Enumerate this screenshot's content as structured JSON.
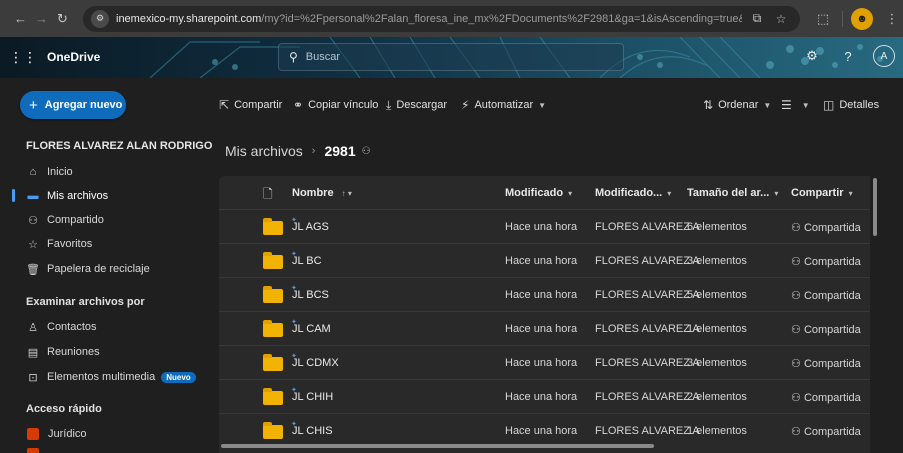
{
  "browser": {
    "url_host": "inemexico-my.sharepoint.com",
    "url_path": "/my?id=%2Fpersonal%2Falan_floresa_ine_mx%2FDocuments%2F2981&ga=1&isAscending=true&sortField=LinkFile..."
  },
  "header": {
    "brand": "OneDrive",
    "search_placeholder": "Buscar",
    "avatar": "A"
  },
  "sidebar": {
    "new_button": "Agregar nuevo",
    "user_name": "FLORES ALVAREZ ALAN RODRIGO",
    "items": [
      {
        "label": "Inicio",
        "icon": "home-icon"
      },
      {
        "label": "Mis archivos",
        "icon": "folder-icon"
      },
      {
        "label": "Compartido",
        "icon": "people-icon"
      },
      {
        "label": "Favoritos",
        "icon": "star-icon"
      },
      {
        "label": "Papelera de reciclaje",
        "icon": "trash-icon"
      }
    ],
    "browse_section": "Examinar archivos por",
    "browse_items": [
      {
        "label": "Contactos",
        "icon": "contact-icon"
      },
      {
        "label": "Reuniones",
        "icon": "meeting-icon"
      },
      {
        "label": "Elementos multimedia",
        "icon": "media-icon",
        "badge": "Nuevo"
      }
    ],
    "quick_section": "Acceso rápido",
    "quick_items": [
      {
        "label": "Jurídico",
        "color": "#d83b01"
      }
    ]
  },
  "commands": {
    "share": "Compartir",
    "copy_link": "Copiar vínculo",
    "download": "Descargar",
    "automate": "Automatizar",
    "sort": "Ordenar",
    "details": "Detalles"
  },
  "breadcrumb": {
    "root": "Mis archivos",
    "current": "2981"
  },
  "table": {
    "columns": {
      "name": "Nombre",
      "modified": "Modificado",
      "modified_by": "Modificado...",
      "size": "Tamaño del ar...",
      "sharing": "Compartir"
    },
    "rows": [
      {
        "name": "JL AGS",
        "modified": "Hace una hora",
        "modified_by": "FLORES ALVAREZ A",
        "size": "6 elementos",
        "sharing": "Compartida"
      },
      {
        "name": "JL BC",
        "modified": "Hace una hora",
        "modified_by": "FLORES ALVAREZ A",
        "size": "3 elementos",
        "sharing": "Compartida"
      },
      {
        "name": "JL BCS",
        "modified": "Hace una hora",
        "modified_by": "FLORES ALVAREZ A",
        "size": "5 elementos",
        "sharing": "Compartida"
      },
      {
        "name": "JL CAM",
        "modified": "Hace una hora",
        "modified_by": "FLORES ALVAREZ A",
        "size": "1 elementos",
        "sharing": "Compartida"
      },
      {
        "name": "JL CDMX",
        "modified": "Hace una hora",
        "modified_by": "FLORES ALVAREZ A",
        "size": "3 elementos",
        "sharing": "Compartida"
      },
      {
        "name": "JL CHIH",
        "modified": "Hace una hora",
        "modified_by": "FLORES ALVAREZ A",
        "size": "2 elementos",
        "sharing": "Compartida"
      },
      {
        "name": "JL CHIS",
        "modified": "Hace una hora",
        "modified_by": "FLORES ALVAREZ A",
        "size": "1 elementos",
        "sharing": "Compartida"
      }
    ]
  },
  "colors": {
    "accent": "#0f6cbd",
    "folder": "#f2b300",
    "quick_access": "#d83b01"
  }
}
